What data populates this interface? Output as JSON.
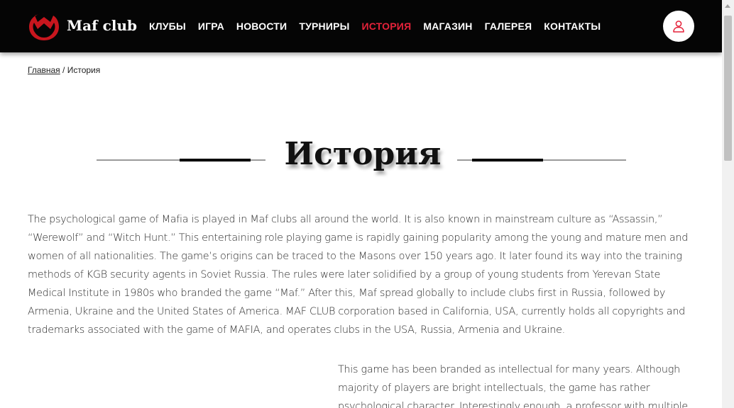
{
  "header": {
    "brand": "Maf club",
    "nav": [
      {
        "label": "КЛУБЫ",
        "active": false
      },
      {
        "label": "ИГРА",
        "active": false
      },
      {
        "label": "НОВОСТИ",
        "active": false
      },
      {
        "label": "ТУРНИРЫ",
        "active": false
      },
      {
        "label": "ИСТОРИЯ",
        "active": true
      },
      {
        "label": "МАГАЗИН",
        "active": false
      },
      {
        "label": "ГАЛЕРЕЯ",
        "active": false
      },
      {
        "label": "КОНТАКТЫ",
        "active": false
      }
    ],
    "user_icon": "user-icon",
    "logo_icon": "maf-logo"
  },
  "breadcrumb": {
    "home": "Главная",
    "separator": "/",
    "current": "История"
  },
  "page": {
    "title": "История"
  },
  "content": {
    "paragraph1": "The psychological game of Mafia is played in Maf clubs all around the world. It is also known in mainstream culture as “Assassin,” “Werewolf” and “Witch Hunt.” This entertaining role playing game is rapidly gaining popularity among the young and mature men and women of all nationalities. The game’s origins can be traced to the Masons over 150 years ago. It later found its way into the training methods of KGB security agents in Soviet Russia. The rules were later solidified by a group of young students from Yerevan State Medical Institute in 1980s who branded the game “Maf.”  After this, Maf spread globally to include clubs first in Russia, followed by Armenia, Ukraine and the United States of America. MAF CLUB corporation based in California, USA, currently holds all copyrights and trademarks associated with the game of MAFIA, and operates clubs in the USA, Russia, Armenia and Ukraine.",
    "paragraph2": "This game has been branded as intellectual for many years. Although majority of players are bright intellectuals, the game has rather psychological character. Interestingly enough, a professor with multiple"
  },
  "colors": {
    "header_bg": "#050505",
    "accent": "#e5223a",
    "text": "#2a2a2a"
  }
}
